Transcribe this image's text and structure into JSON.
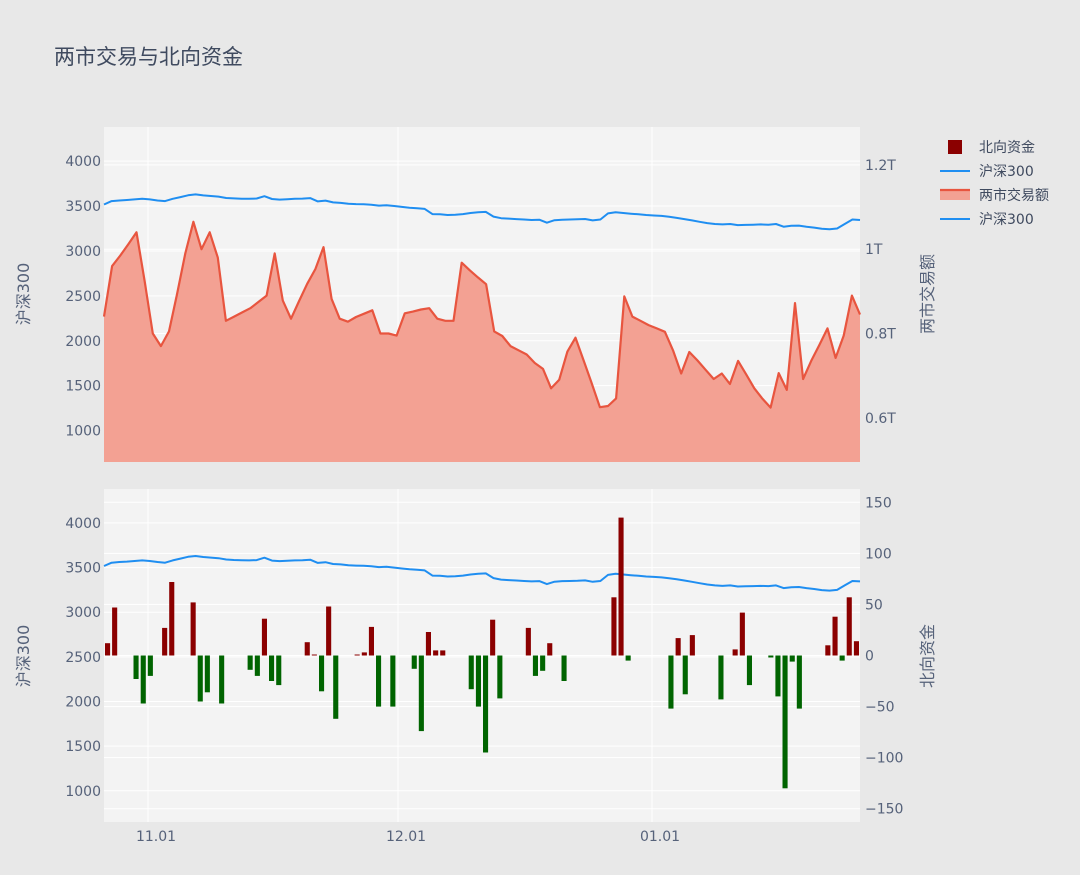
{
  "title": "两市交易与北向资金",
  "colors": {
    "page_bg": "#e8e8e8",
    "plot_bg": "#f3f3f3",
    "grid": "#ffffff",
    "hs300": "#1f8ef1",
    "turnover_line": "#e8553f",
    "turnover_fill": "#f3a193",
    "north_pos": "#8b0000",
    "north_neg": "#006400"
  },
  "legend": [
    {
      "label": "北向资金",
      "type": "square",
      "color_key": "north_pos"
    },
    {
      "label": "沪深300",
      "type": "line",
      "color_key": "hs300"
    },
    {
      "label": "两市交易额",
      "type": "area",
      "color_key": "turnover_line"
    },
    {
      "label": "沪深300",
      "type": "line",
      "color_key": "hs300"
    }
  ],
  "chart_data": [
    {
      "type": "area",
      "name": "top-panel",
      "x_ticks": [
        "11.01",
        "12.01",
        "01.01"
      ],
      "y_left": {
        "label": "沪深300",
        "range": [
          650,
          4380
        ],
        "ticks": [
          1000,
          1500,
          2000,
          2500,
          3000,
          3500,
          4000
        ]
      },
      "y_right": {
        "label": "两市交易额",
        "range": [
          0.495,
          1.29
        ],
        "ticks": [
          0.6,
          0.8,
          1.0,
          1.2
        ],
        "tick_labels": [
          "0.6T",
          "0.8T",
          "1T",
          "1.2T"
        ]
      },
      "series": [
        {
          "name": "沪深300",
          "axis": "left",
          "kind": "line",
          "values": [
            3517,
            3555,
            3562,
            3567,
            3574,
            3580,
            3574,
            3562,
            3555,
            3580,
            3600,
            3620,
            3630,
            3618,
            3612,
            3605,
            3590,
            3585,
            3582,
            3580,
            3584,
            3610,
            3578,
            3572,
            3576,
            3580,
            3583,
            3588,
            3552,
            3560,
            3540,
            3535,
            3525,
            3522,
            3520,
            3515,
            3505,
            3508,
            3500,
            3490,
            3480,
            3475,
            3468,
            3410,
            3408,
            3400,
            3402,
            3410,
            3422,
            3430,
            3435,
            3382,
            3365,
            3360,
            3355,
            3350,
            3345,
            3348,
            3315,
            3342,
            3348,
            3350,
            3352,
            3356,
            3340,
            3350,
            3418,
            3430,
            3422,
            3415,
            3408,
            3400,
            3395,
            3390,
            3380,
            3368,
            3355,
            3340,
            3325,
            3310,
            3300,
            3295,
            3300,
            3288,
            3290,
            3292,
            3295,
            3292,
            3300,
            3270,
            3280,
            3282,
            3270,
            3260,
            3248,
            3242,
            3250,
            3300,
            3350,
            3345
          ]
        },
        {
          "name": "两市交易额",
          "axis": "right",
          "kind": "area",
          "values": [
            0.84,
            0.96,
            0.985,
            1.012,
            1.04,
            0.925,
            0.8,
            0.77,
            0.805,
            0.895,
            0.99,
            1.065,
            1.0,
            1.04,
            0.98,
            0.83,
            0.84,
            0.85,
            0.86,
            0.875,
            0.89,
            0.99,
            0.878,
            0.835,
            0.877,
            0.918,
            0.953,
            1.005,
            0.882,
            0.835,
            0.828,
            0.839,
            0.847,
            0.855,
            0.8,
            0.8,
            0.795,
            0.848,
            0.852,
            0.857,
            0.86,
            0.835,
            0.83,
            0.83,
            0.968,
            0.95,
            0.933,
            0.917,
            0.805,
            0.794,
            0.77,
            0.76,
            0.75,
            0.73,
            0.716,
            0.67,
            0.69,
            0.757,
            0.79,
            0.736,
            0.682,
            0.625,
            0.628,
            0.646,
            0.888,
            0.84,
            0.83,
            0.82,
            0.812,
            0.804,
            0.76,
            0.705,
            0.756,
            0.736,
            0.714,
            0.692,
            0.705,
            0.68,
            0.735,
            0.703,
            0.67,
            0.645,
            0.624,
            0.706,
            0.666,
            0.872,
            0.692,
            0.735,
            0.773,
            0.812,
            0.742,
            0.795,
            0.89,
            0.845
          ]
        }
      ]
    },
    {
      "type": "bar",
      "name": "bottom-panel",
      "x_ticks": [
        "11.01",
        "12.01",
        "01.01"
      ],
      "y_left": {
        "label": "沪深300",
        "range": [
          650,
          4380
        ],
        "ticks": [
          1000,
          1500,
          2000,
          2500,
          3000,
          3500,
          4000
        ]
      },
      "y_right": {
        "label": "北向资金",
        "range": [
          -163,
          163
        ],
        "ticks": [
          -150,
          -100,
          -50,
          0,
          50,
          100,
          150
        ],
        "tick_labels": [
          "−150",
          "−100",
          "−50",
          "0",
          "50",
          "100",
          "150"
        ]
      },
      "series": [
        {
          "name": "沪深300",
          "axis": "left",
          "kind": "line",
          "values": [
            3517,
            3555,
            3562,
            3567,
            3574,
            3580,
            3574,
            3562,
            3555,
            3580,
            3600,
            3620,
            3630,
            3618,
            3612,
            3605,
            3590,
            3585,
            3582,
            3580,
            3584,
            3610,
            3578,
            3572,
            3576,
            3580,
            3583,
            3588,
            3552,
            3560,
            3540,
            3535,
            3525,
            3522,
            3520,
            3515,
            3505,
            3508,
            3500,
            3490,
            3480,
            3475,
            3468,
            3410,
            3408,
            3400,
            3402,
            3410,
            3422,
            3430,
            3435,
            3382,
            3365,
            3360,
            3355,
            3350,
            3345,
            3348,
            3315,
            3342,
            3348,
            3350,
            3352,
            3356,
            3340,
            3350,
            3418,
            3430,
            3422,
            3415,
            3408,
            3400,
            3395,
            3390,
            3380,
            3368,
            3355,
            3340,
            3325,
            3310,
            3300,
            3295,
            3300,
            3288,
            3290,
            3292,
            3295,
            3292,
            3300,
            3270,
            3280,
            3282,
            3270,
            3260,
            3248,
            3242,
            3250,
            3300,
            3350,
            3345
          ]
        },
        {
          "name": "北向资金",
          "axis": "right",
          "kind": "bar",
          "values": [
            12,
            47,
            0,
            0,
            -23,
            -47,
            -20,
            0,
            27,
            72,
            0,
            0,
            52,
            -45,
            -36,
            0,
            -47,
            0,
            0,
            0,
            -14,
            -20,
            36,
            -25,
            -29,
            0,
            0,
            0,
            13,
            1,
            -35,
            48,
            -62,
            0,
            0,
            1,
            3,
            28,
            -50,
            0,
            -50,
            0,
            0,
            -13,
            -74,
            23,
            5,
            5,
            0,
            0,
            0,
            -33,
            -50,
            -95,
            35,
            -42,
            0,
            0,
            0,
            27,
            -20,
            -15,
            12,
            0,
            -25,
            0,
            0,
            0,
            0,
            0,
            0,
            57,
            135,
            -5,
            0,
            0,
            0,
            0,
            0,
            -52,
            17,
            -38,
            20,
            0,
            0,
            0,
            -43,
            0,
            6,
            42,
            -29,
            0,
            0,
            -2,
            -40,
            -130,
            -6,
            -52,
            0,
            0,
            0,
            10,
            38,
            -5,
            57,
            14
          ]
        }
      ]
    }
  ]
}
